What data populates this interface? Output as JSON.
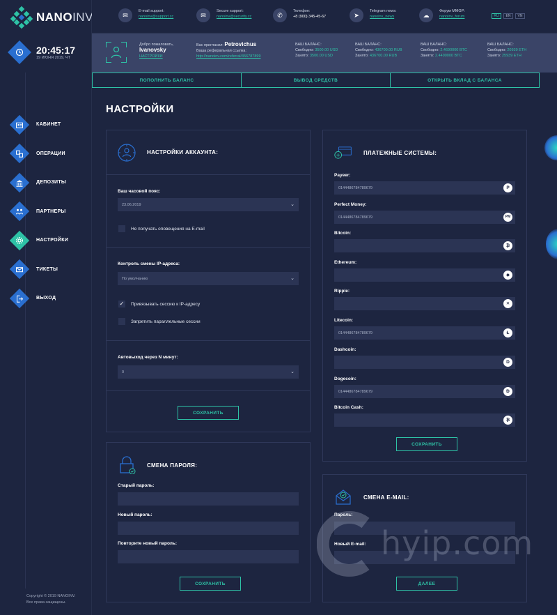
{
  "brand": {
    "name_bold": "NANO",
    "name_light": "INV"
  },
  "clock": {
    "time": "20:45:17",
    "date": "19 ИЮНЯ 2019, ЧТ"
  },
  "nav": [
    {
      "label": "КАБИНЕТ",
      "icon": "id-card-icon"
    },
    {
      "label": "ОПЕРАЦИИ",
      "icon": "operations-icon"
    },
    {
      "label": "ДЕПОЗИТЫ",
      "icon": "bank-icon"
    },
    {
      "label": "ПАРТНЕРЫ",
      "icon": "partners-icon"
    },
    {
      "label": "НАСТРОЙКИ",
      "icon": "gear-icon",
      "active": true
    },
    {
      "label": "ТИКЕТЫ",
      "icon": "mail-icon"
    },
    {
      "label": "ВЫХОД",
      "icon": "logout-icon"
    }
  ],
  "copyright": {
    "line1": "Copyright © 2019 NANOINV.",
    "line2": "Все права защищены."
  },
  "contacts": [
    {
      "label": "E-mail support:",
      "value": "nanoinv@support.cc",
      "icon": "mail-icon"
    },
    {
      "label": "Secure support:",
      "value": "nanoinv@security.cc",
      "icon": "mail-icon"
    },
    {
      "label": "Телефон:",
      "value": "+8 (900) 345-45-67",
      "icon": "phone-icon"
    },
    {
      "label": "Telegram news:",
      "value": "nanoinv_news",
      "icon": "telegram-icon"
    },
    {
      "label": "Форум MMGP:",
      "value": "nanoinv_forum",
      "icon": "forum-icon"
    }
  ],
  "langs": [
    "RU",
    "EN",
    "VN"
  ],
  "user": {
    "welcome": "Добро пожаловать,",
    "name": "Ivanovsky",
    "settings_link": "НАСТРОЙКИ",
    "invited_label": "Вас пригласил:",
    "inviter": "Petrovichus",
    "ref_label": "Ваша реферальная ссылка:",
    "ref_link": "http://nanoinv.com/referral/456787899"
  },
  "balances": [
    {
      "title": "ВАШ БАЛАНС:",
      "free_label": "Свободно:",
      "free": "3500.00 USD",
      "busy_label": "Занято:",
      "busy": "3500.00 USD"
    },
    {
      "title": "ВАШ БАЛАНС:",
      "free_label": "Свободно:",
      "free": "436700.00 RUB",
      "busy_label": "Занято:",
      "busy": "436700.00 RUB"
    },
    {
      "title": "ВАШ БАЛАНС:",
      "free_label": "Свободно:",
      "free": "2.4690000 BTC",
      "busy_label": "Занято:",
      "busy": "2.4490000 BTC"
    },
    {
      "title": "ВАШ БАЛАНС:",
      "free_label": "Свободно:",
      "free": "20939 ETH",
      "busy_label": "Занято:",
      "busy": "25939 ETH"
    }
  ],
  "actions": [
    "ПОПОЛНИТЬ БАЛАНС",
    "ВЫВОД СРЕДСТВ",
    "ОТКРЫТЬ ВКЛАД С БАЛАНСА"
  ],
  "page_title": "НАСТРОЙКИ",
  "account": {
    "title": "НАСТРОЙКИ АККАУНТА:",
    "tz_label": "Ваш часовой пояс:",
    "tz_value": "23.06.2019",
    "no_email": "Не получать оповещения на E-mail",
    "ip_label": "Контроль смены IP-адреса:",
    "ip_value": "По умолчанию",
    "bind_ip": "Привязывать сессию к IP-адресу",
    "no_parallel": "Запретить параллельные сессии",
    "autologout_label": "Автовыход через N минут:",
    "autologout_value": "0",
    "save": "СОХРАНИТЬ"
  },
  "password": {
    "title": "СМЕНА ПАРОЛЯ:",
    "old": "Старый пароль:",
    "new": "Новый пароль:",
    "repeat": "Повторите новый пароль:",
    "save": "СОХРАНИТЬ"
  },
  "payments": {
    "title": "ПЛАТЕЖНЫЕ СИСТЕМЫ:",
    "items": [
      {
        "label": "Payeer:",
        "value": "0144486784789679",
        "coin": "P"
      },
      {
        "label": "Perfect Money:",
        "value": "0144486784789679",
        "coin": "PM"
      },
      {
        "label": "Bitcoin:",
        "value": "",
        "coin": "₿"
      },
      {
        "label": "Ethereum:",
        "value": "",
        "coin": "◆"
      },
      {
        "label": "Ripple:",
        "value": "",
        "coin": "✕"
      },
      {
        "label": "Litecoin:",
        "value": "0144486784789679",
        "coin": "Ł"
      },
      {
        "label": "Dashcoin:",
        "value": "",
        "coin": "D"
      },
      {
        "label": "Dogecoin:",
        "value": "0144486784789679",
        "coin": "Ð"
      },
      {
        "label": "Bitcoin Cash:",
        "value": "",
        "coin": "₿"
      }
    ],
    "save": "СОХРАНИТЬ"
  },
  "email": {
    "title": "СМЕНА E-MAIL:",
    "password": "Пароль:",
    "new_email": "Новый E-mail:",
    "next": "ДАЛЕЕ"
  },
  "watermark": "hyip.com",
  "colors": {
    "accent": "#2ec2a6",
    "blue": "#2a6fd0",
    "bg": "#1d2540",
    "band": "#3a4467",
    "field": "#2b3454"
  }
}
